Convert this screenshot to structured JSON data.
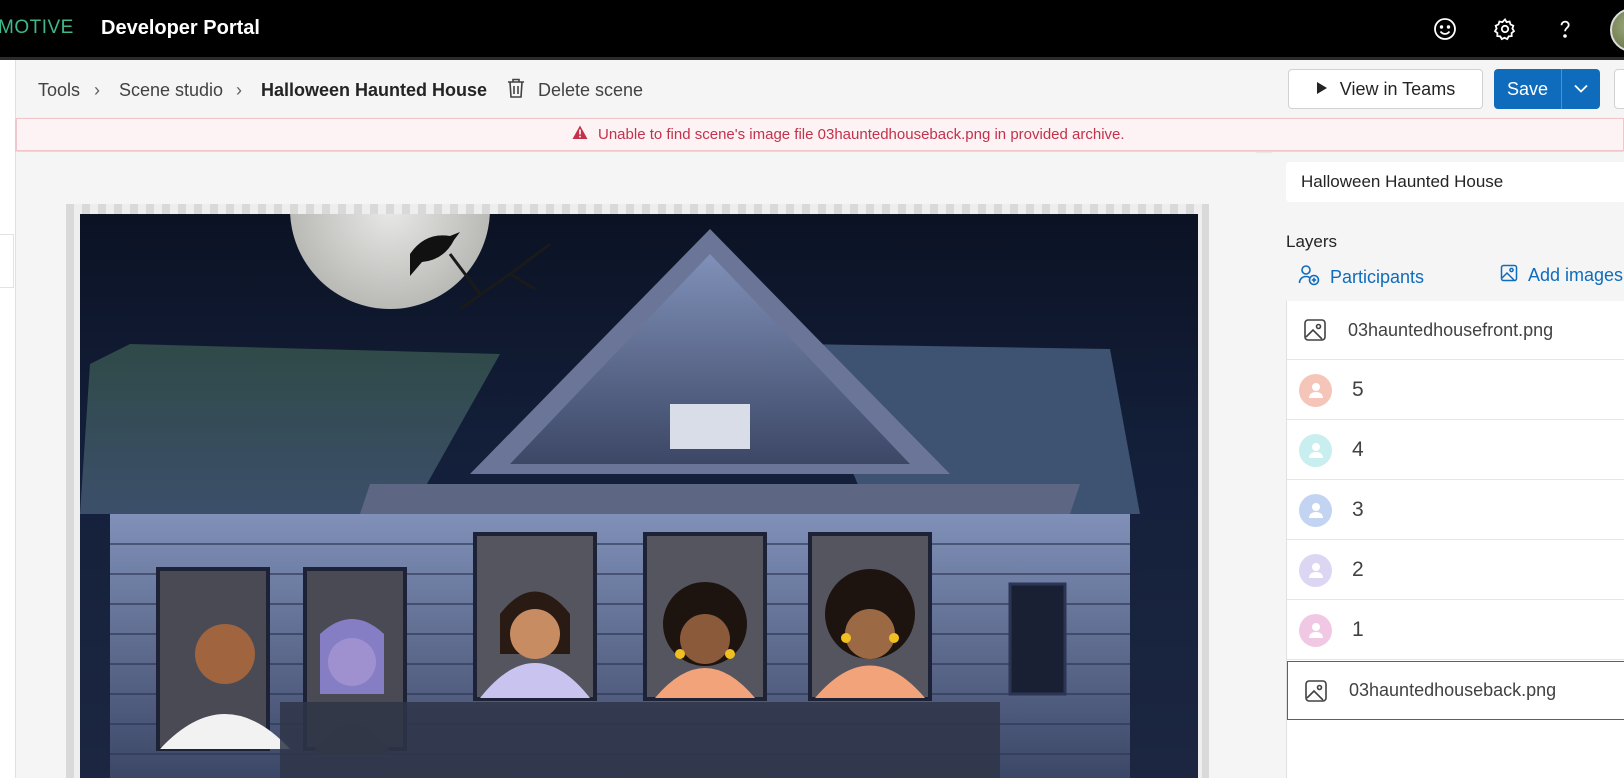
{
  "topbar": {
    "brand": "MOTIVE",
    "title": "Developer Portal",
    "icons": [
      "feedback-smiley-icon",
      "settings-gear-icon",
      "help-question-icon",
      "account-avatar"
    ]
  },
  "breadcrumb": {
    "items": [
      "Tools",
      "Scene studio",
      "Halloween Haunted House"
    ],
    "separator": "›"
  },
  "toolbar": {
    "delete_label": "Delete scene",
    "view_teams_label": "View in Teams",
    "save_label": "Save"
  },
  "banner": {
    "message": "Unable to find scene's image file 03hauntedhouseback.png in provided archive."
  },
  "scene_panel": {
    "scene_name": "Halloween Haunted House",
    "layers_title": "Layers",
    "participants_label": "Participants",
    "add_images_label": "Add images"
  },
  "layers": [
    {
      "type": "image",
      "label": "03hauntedhousefront.png"
    },
    {
      "type": "participant",
      "label": "5",
      "color": "#f4c5b8",
      "figure": "#e89a86"
    },
    {
      "type": "participant",
      "label": "4",
      "color": "#c9eef0",
      "figure": "#8fd7dc"
    },
    {
      "type": "participant",
      "label": "3",
      "color": "#c3d4f3",
      "figure": "#8eaee6"
    },
    {
      "type": "participant",
      "label": "2",
      "color": "#dcd6f3",
      "figure": "#b8aee7"
    },
    {
      "type": "participant",
      "label": "1",
      "color": "#f1c8e4",
      "figure": "#e29acb"
    },
    {
      "type": "image",
      "label": "03hauntedhouseback.png",
      "selected": true
    }
  ],
  "colors": {
    "accent": "#0f6cbd",
    "error": "#c4314b",
    "brand": "#3fb88a"
  }
}
